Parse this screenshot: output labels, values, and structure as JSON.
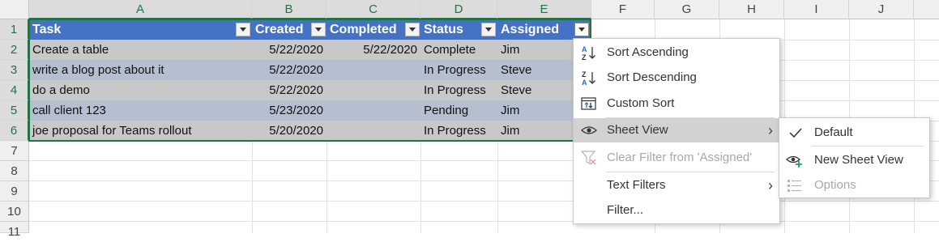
{
  "columns": [
    "A",
    "B",
    "C",
    "D",
    "E",
    "F",
    "G",
    "H",
    "I",
    "J"
  ],
  "rows": [
    "1",
    "2",
    "3",
    "4",
    "5",
    "6",
    "7",
    "8",
    "9",
    "10",
    "11"
  ],
  "table": {
    "headers": [
      "Task",
      "Created",
      "Completed",
      "Status",
      "Assigned"
    ],
    "rows": [
      [
        "Create a table",
        "5/22/2020",
        "5/22/2020",
        "Complete",
        "Jim"
      ],
      [
        "write a blog post about it",
        "5/22/2020",
        "",
        "In Progress",
        "Steve"
      ],
      [
        "do a demo",
        "5/22/2020",
        "",
        "In Progress",
        "Steve"
      ],
      [
        "call client 123",
        "5/23/2020",
        "",
        "Pending",
        "Jim"
      ],
      [
        "joe proposal for Teams rollout",
        "5/20/2020",
        "",
        "In Progress",
        "Jim"
      ]
    ]
  },
  "menu": {
    "sort_ascending": "Sort Ascending",
    "sort_descending": "Sort Descending",
    "custom_sort": "Custom Sort",
    "sheet_view": "Sheet View",
    "clear_filter": "Clear Filter from 'Assigned'",
    "text_filters": "Text Filters",
    "filter": "Filter..."
  },
  "submenu": {
    "default": "Default",
    "new_sheet_view": "New Sheet View",
    "options": "Options"
  },
  "colors": {
    "table_header": "#4472c4",
    "selection": "#217346",
    "menu_hover": "#d2d2d2"
  }
}
